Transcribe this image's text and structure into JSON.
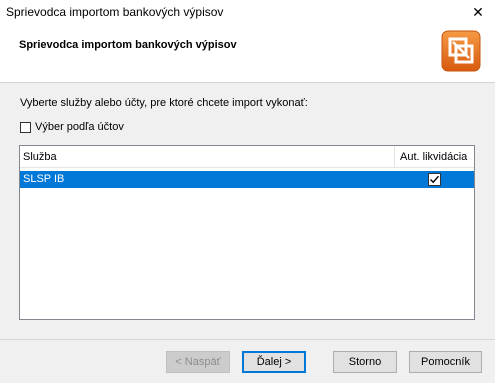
{
  "window": {
    "title": "Sprievodca importom bankových výpisov",
    "close_glyph": "✕"
  },
  "header": {
    "title": "Sprievodca importom bankových výpisov",
    "logo_icon": "wizard-logo-icon"
  },
  "main": {
    "instruction": "Vyberte služby alebo účty, pre ktoré chcete import vykonať:",
    "checkbox": {
      "label": "Výber podľa účtov",
      "checked": false
    },
    "list": {
      "columns": [
        "Služba",
        "Aut. likvidácia"
      ],
      "rows": [
        {
          "service": "SLSP IB",
          "auto": true
        }
      ]
    }
  },
  "footer": {
    "back": "< Naspäť",
    "next": "Ďalej >",
    "cancel": "Storno",
    "help": "Pomocník"
  },
  "colors": {
    "selection": "#0078d7",
    "logo_orange": "#e8711c"
  }
}
